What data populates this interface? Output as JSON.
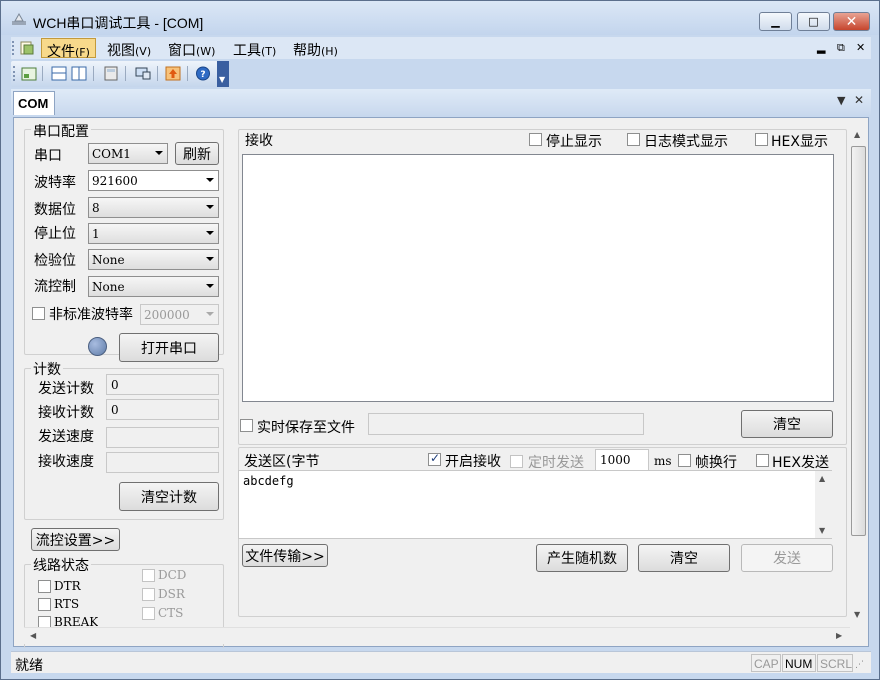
{
  "window": {
    "title": "WCH串口调试工具 - [COM]"
  },
  "menu": [
    {
      "label": "文件",
      "acc": "(F)"
    },
    {
      "label": "视图",
      "acc": "(V)"
    },
    {
      "label": "窗口",
      "acc": "(W)"
    },
    {
      "label": "工具",
      "acc": "(T)"
    },
    {
      "label": "帮助",
      "acc": "(H)"
    }
  ],
  "tab": {
    "label": "COM"
  },
  "serial_config": {
    "group_label": "串口配置",
    "port_label": "串口",
    "port_value": "COM1",
    "refresh_label": "刷新",
    "baud_label": "波特率",
    "baud_value": "921600",
    "databits_label": "数据位",
    "databits_value": "8",
    "stopbits_label": "停止位",
    "stopbits_value": "1",
    "parity_label": "检验位",
    "parity_value": "None",
    "flow_label": "流控制",
    "flow_value": "None",
    "nonstd_label": "非标准波特率",
    "nonstd_value": "200000",
    "open_label": "打开串口"
  },
  "counters": {
    "group_label": "计数",
    "send_count_label": "发送计数",
    "send_count_value": "0",
    "recv_count_label": "接收计数",
    "recv_count_value": "0",
    "send_speed_label": "发送速度",
    "send_speed_value": "",
    "recv_speed_label": "接收速度",
    "recv_speed_value": "",
    "clear_label": "清空计数"
  },
  "flow_settings_label": "流控设置>>",
  "line_status": {
    "group_label": "线路状态",
    "items": [
      "DTR",
      "RTS",
      "BREAK",
      "DCD",
      "DSR",
      "CTS"
    ]
  },
  "receive": {
    "label": "接收",
    "stop_display_label": "停止显示",
    "log_mode_label": "日志模式显示",
    "hex_display_label": "HEX显示",
    "save_label": "实时保存至文件",
    "save_path": "",
    "clear_label": "清空"
  },
  "send": {
    "label": "发送区(字节",
    "enable_recv_label": "开启接收",
    "timed_send_label": "定时发送",
    "interval_value": "1000",
    "interval_unit": "ms",
    "newline_label": "帧换行",
    "hex_send_label": "HEX发送",
    "text": "abcdefg",
    "file_transfer_label": "文件传输>>",
    "random_label": "产生随机数",
    "clear_label": "清空",
    "send_label": "发送"
  },
  "statusbar": {
    "text": "就绪",
    "indicators": [
      {
        "label": "CAP",
        "active": false
      },
      {
        "label": "NUM",
        "active": true
      },
      {
        "label": "SCRL",
        "active": false
      }
    ]
  },
  "colors": {
    "title_bg": "#c3d5ed",
    "close_btn": "#c6452d",
    "menu_active": "#f8d98b",
    "led": "#5f7ca8"
  }
}
